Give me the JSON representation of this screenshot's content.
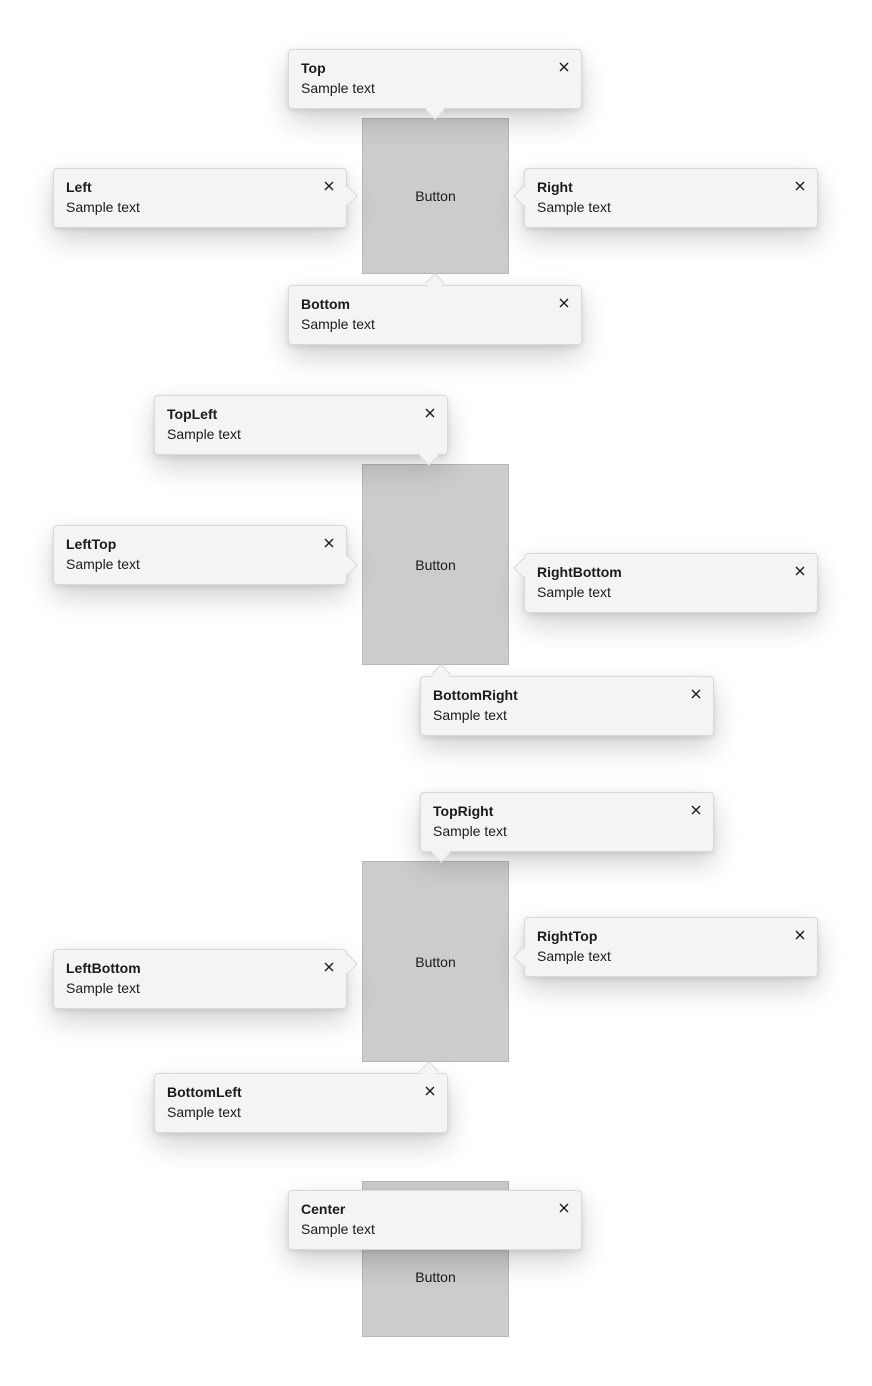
{
  "targets": {
    "g1": "Button",
    "g2": "Button",
    "g3": "Button",
    "g4": "Button"
  },
  "tips": {
    "top": {
      "title": "Top",
      "body": "Sample text"
    },
    "left": {
      "title": "Left",
      "body": "Sample text"
    },
    "right": {
      "title": "Right",
      "body": "Sample text"
    },
    "bottom": {
      "title": "Bottom",
      "body": "Sample text"
    },
    "topLeft": {
      "title": "TopLeft",
      "body": "Sample text"
    },
    "leftTop": {
      "title": "LeftTop",
      "body": "Sample text"
    },
    "rightBottom": {
      "title": "RightBottom",
      "body": "Sample text"
    },
    "bottomRight": {
      "title": "BottomRight",
      "body": "Sample text"
    },
    "topRight": {
      "title": "TopRight",
      "body": "Sample text"
    },
    "leftBottom": {
      "title": "LeftBottom",
      "body": "Sample text"
    },
    "rightTop": {
      "title": "RightTop",
      "body": "Sample text"
    },
    "bottomLeft": {
      "title": "BottomLeft",
      "body": "Sample text"
    },
    "center": {
      "title": "Center",
      "body": "Sample text"
    }
  }
}
